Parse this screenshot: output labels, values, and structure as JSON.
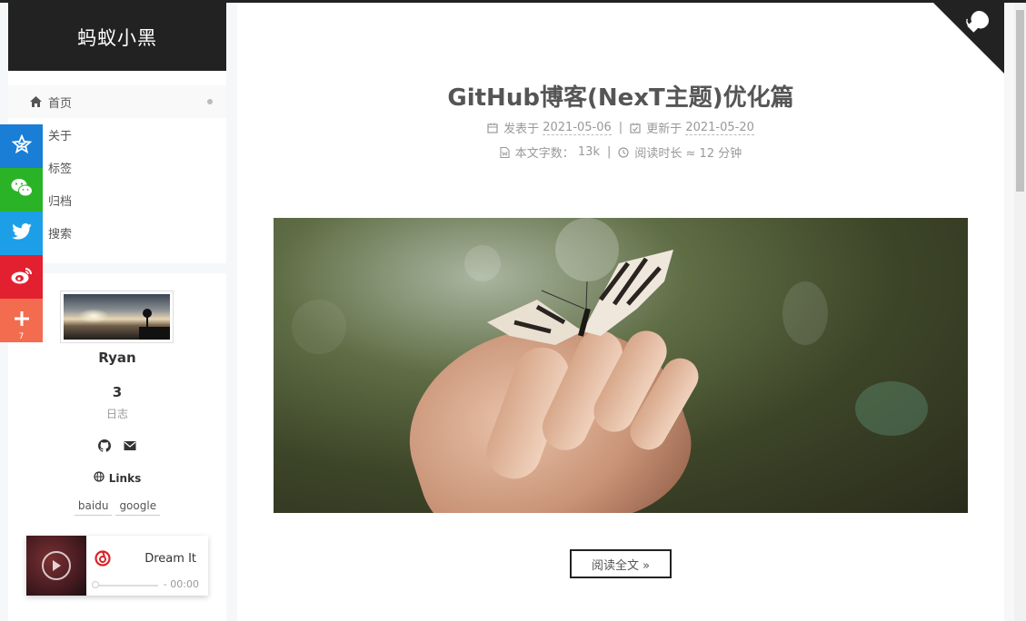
{
  "site": {
    "brand": "蚂蚁小黑"
  },
  "menu": {
    "items": [
      {
        "label": "首页",
        "icon": "home-icon",
        "active": true
      },
      {
        "label": "关于",
        "icon": "user-icon"
      },
      {
        "label": "标签",
        "icon": "tags-icon"
      },
      {
        "label": "归档",
        "icon": "archive-icon"
      },
      {
        "label": "搜索",
        "icon": "search-icon"
      }
    ]
  },
  "share": {
    "buttons": [
      {
        "icon": "qzone-star-icon",
        "color": "#1a7dd6"
      },
      {
        "icon": "wechat-icon",
        "color": "#2bb327"
      },
      {
        "icon": "twitter-icon",
        "color": "#1c9fe6"
      },
      {
        "icon": "weibo-icon",
        "color": "#e3202f"
      },
      {
        "icon": "plus-icon",
        "color": "#f36c4f",
        "count": "7"
      }
    ]
  },
  "profile": {
    "author": "Ryan",
    "posts_count": "3",
    "posts_label": "日志",
    "links_title": "Links",
    "links": [
      "baidu",
      "google"
    ]
  },
  "player": {
    "track": "Dream It",
    "time": "- 00:00",
    "progress": 0.0
  },
  "post": {
    "title": "GitHub博客(NexT主题)优化篇",
    "published_label": "发表于",
    "published_date": "2021-05-06",
    "updated_label": "更新于",
    "updated_date": "2021-05-20",
    "wordcount_label": "本文字数：",
    "wordcount": "13k",
    "readtime_label": "阅读时长 ≈",
    "readtime": "12 分钟",
    "read_more": "阅读全文 »"
  },
  "colors": {
    "brand_bg": "#222222",
    "text": "#555555",
    "muted": "#999999"
  }
}
